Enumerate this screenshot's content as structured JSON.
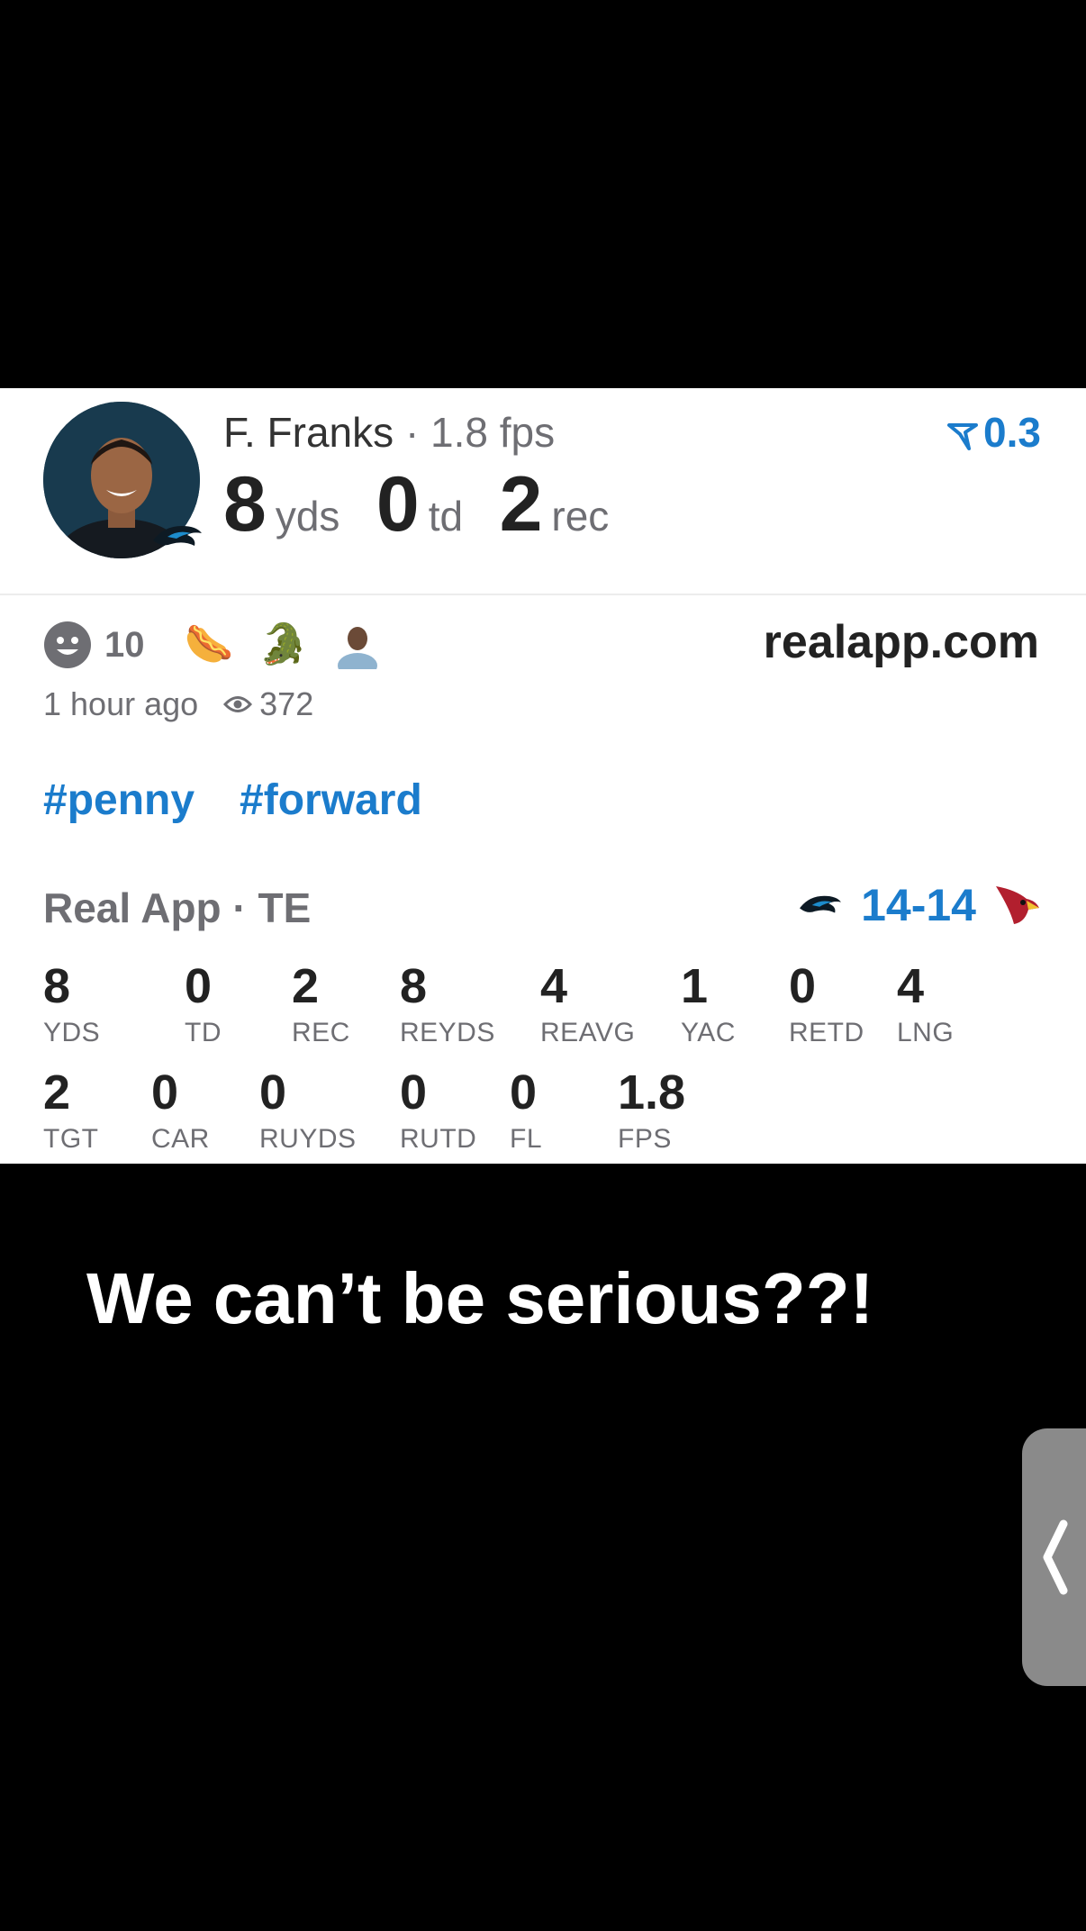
{
  "player": {
    "name": "F. Franks",
    "separator": "·",
    "fps": "1.8 fps",
    "yds_value": "8",
    "yds_unit": "yds",
    "td_value": "0",
    "td_unit": "td",
    "rec_value": "2",
    "rec_unit": "rec",
    "price": "0.3"
  },
  "reactions": {
    "count": "10",
    "emojis": [
      "🌭",
      "🐊"
    ]
  },
  "site": "realapp.com",
  "meta": {
    "time": "1 hour ago",
    "views": "372"
  },
  "tags": [
    "#penny",
    "#forward"
  ],
  "game": {
    "app": "Real App",
    "position": "TE",
    "score": "14-14"
  },
  "stats_row1": [
    {
      "value": "8",
      "label": "YDS"
    },
    {
      "value": "0",
      "label": "TD"
    },
    {
      "value": "2",
      "label": "REC"
    },
    {
      "value": "8",
      "label": "REYDS"
    },
    {
      "value": "4",
      "label": "REAVG"
    },
    {
      "value": "1",
      "label": "YAC"
    },
    {
      "value": "0",
      "label": "RETD"
    },
    {
      "value": "4",
      "label": "LNG"
    }
  ],
  "stats_row2": [
    {
      "value": "2",
      "label": "TGT"
    },
    {
      "value": "0",
      "label": "CAR"
    },
    {
      "value": "0",
      "label": "RUYDS"
    },
    {
      "value": "0",
      "label": "RUTD"
    },
    {
      "value": "0",
      "label": "FL"
    },
    {
      "value": "1.8",
      "label": "FPS"
    }
  ],
  "caption": "We can’t be serious??!",
  "colors": {
    "accent": "#1b7ccc",
    "muted": "#6e6e73",
    "text": "#222222"
  }
}
